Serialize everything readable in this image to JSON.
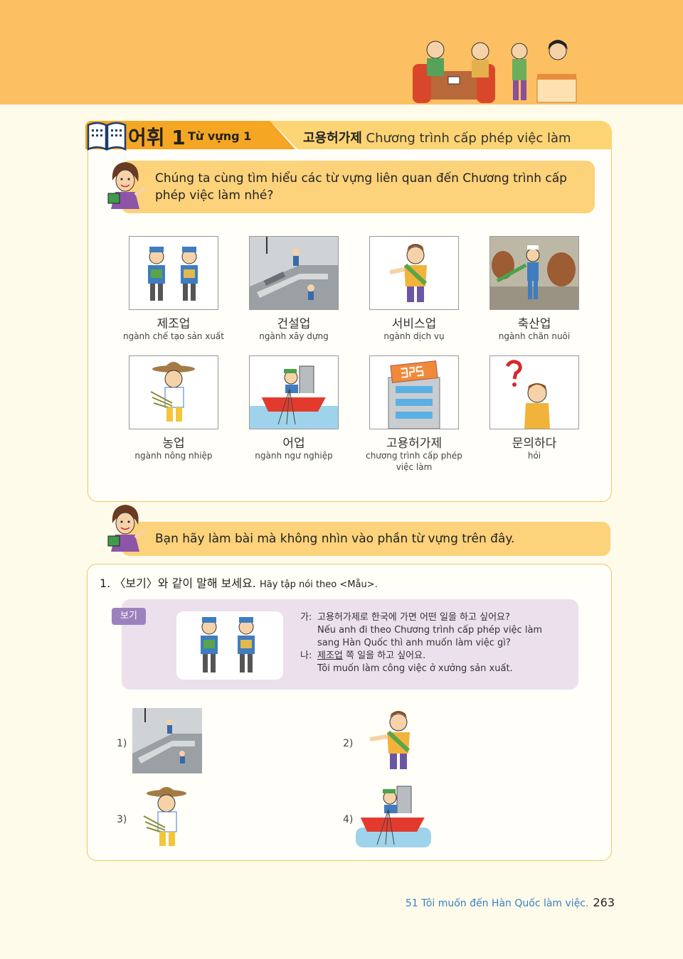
{
  "header": {
    "lesson_ko": "어휘 1",
    "lesson_vi": "Từ vựng 1",
    "topic_ko": "고용허가제",
    "topic_vi": "Chương trình cấp phép việc làm"
  },
  "intro_bubble": "Chúng ta cùng tìm hiểu các từ vựng liên quan đến Chương trình cấp phép việc làm nhé?",
  "vocab": [
    {
      "ko": "제조업",
      "vi": "ngành chế tạo sản xuất",
      "icon": "factory-workers-icon"
    },
    {
      "ko": "건설업",
      "vi": "ngành xây dựng",
      "icon": "construction-site-icon"
    },
    {
      "ko": "서비스업",
      "vi": "ngành dịch vụ",
      "icon": "service-worker-icon"
    },
    {
      "ko": "축산업",
      "vi": "ngành chăn nuôi",
      "icon": "livestock-icon"
    },
    {
      "ko": "농업",
      "vi": "ngành nông nhiệp",
      "icon": "farmer-icon"
    },
    {
      "ko": "어업",
      "vi": "ngành ngư nghiệp",
      "icon": "fishing-boat-icon"
    },
    {
      "ko": "고용허가제",
      "vi": "chương trình cấp phép việc làm",
      "icon": "eps-building-icon"
    },
    {
      "ko": "문의하다",
      "vi": "hỏi",
      "icon": "question-person-icon"
    }
  ],
  "instruction_bubble": "Bạn hãy làm bài mà không nhìn vào phần từ vựng trên đây.",
  "exercise": {
    "heading_ko": "1. 〈보기〉와 같이 말해 보세요.",
    "heading_vi": "Hãy tập nói theo <Mẫu>.",
    "example_tag": "보기",
    "dialog": {
      "a_speaker": "가:",
      "a_ko": "고용허가제로 한국에 가면 어떤 일을 하고 싶어요?",
      "a_vi_1": "Nếu anh đi theo Chương trình cấp phép việc làm",
      "a_vi_2": "sang Hàn Quốc thì anh muốn làm việc gì?",
      "b_speaker": "나:",
      "b_ko_underlined": "제조업",
      "b_ko_rest": " 쪽 일을 하고 싶어요.",
      "b_vi": "Tôi muốn làm công việc ở xưởng sản xuất."
    },
    "questions": [
      "1)",
      "2)",
      "3)",
      "4)"
    ]
  },
  "footer": {
    "lesson": "51 Tôi muốn đến Hàn Quốc làm việc.",
    "page": "263"
  },
  "colors": {
    "top_band": "#fcc063",
    "title_orange": "#f5a623",
    "bubble": "#fcd27a",
    "example_box": "#ece0ec",
    "tag": "#9c82bd",
    "footer_text": "#3a7fc0"
  }
}
